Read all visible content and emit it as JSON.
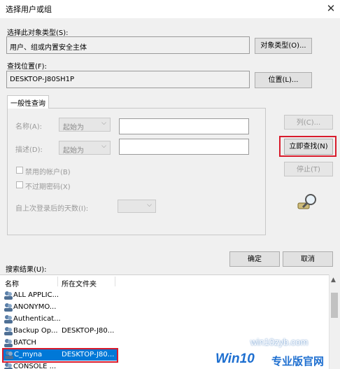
{
  "window": {
    "title": "选择用户或组",
    "close_glyph": "✕"
  },
  "object_type": {
    "label": "选择此对象类型(S):",
    "value": "用户、组或内置安全主体",
    "button": "对象类型(O)..."
  },
  "location": {
    "label": "查找位置(F):",
    "value": "DESKTOP-J80SH1P",
    "button": "位置(L)..."
  },
  "tab": {
    "label": "一般性查询"
  },
  "query": {
    "name_label": "名称(A):",
    "name_mode": "起始为",
    "desc_label": "描述(D):",
    "desc_mode": "起始为",
    "disabled_accounts_label": "禁用的帐户(B)",
    "no_expire_label": "不过期密码(X)",
    "days_label": "自上次登录后的天数(I):"
  },
  "side_buttons": {
    "columns": "列(C)...",
    "find_now": "立即查找(N)",
    "stop": "停止(T)"
  },
  "dialog_buttons": {
    "ok": "确定",
    "cancel": "取消"
  },
  "results": {
    "label": "搜索结果(U):",
    "columns": [
      "名称",
      "所在文件夹"
    ],
    "rows": [
      {
        "name": "ALL APPLIC...",
        "folder": "",
        "selected": false
      },
      {
        "name": "ANONYMO...",
        "folder": "",
        "selected": false
      },
      {
        "name": "Authenticat...",
        "folder": "",
        "selected": false
      },
      {
        "name": "Backup Op...",
        "folder": "DESKTOP-J80...",
        "selected": false
      },
      {
        "name": "BATCH",
        "folder": "",
        "selected": false
      },
      {
        "name": "C_myna",
        "folder": "DESKTOP-J80...",
        "selected": true
      },
      {
        "name": "CONSOLE ...",
        "folder": "",
        "selected": false
      }
    ]
  },
  "watermark": {
    "brand": "Win10",
    "suffix": "专业版官网",
    "url": "win10zyb.com"
  },
  "colors": {
    "accent": "#0078d7",
    "highlight": "#d81b2c"
  }
}
